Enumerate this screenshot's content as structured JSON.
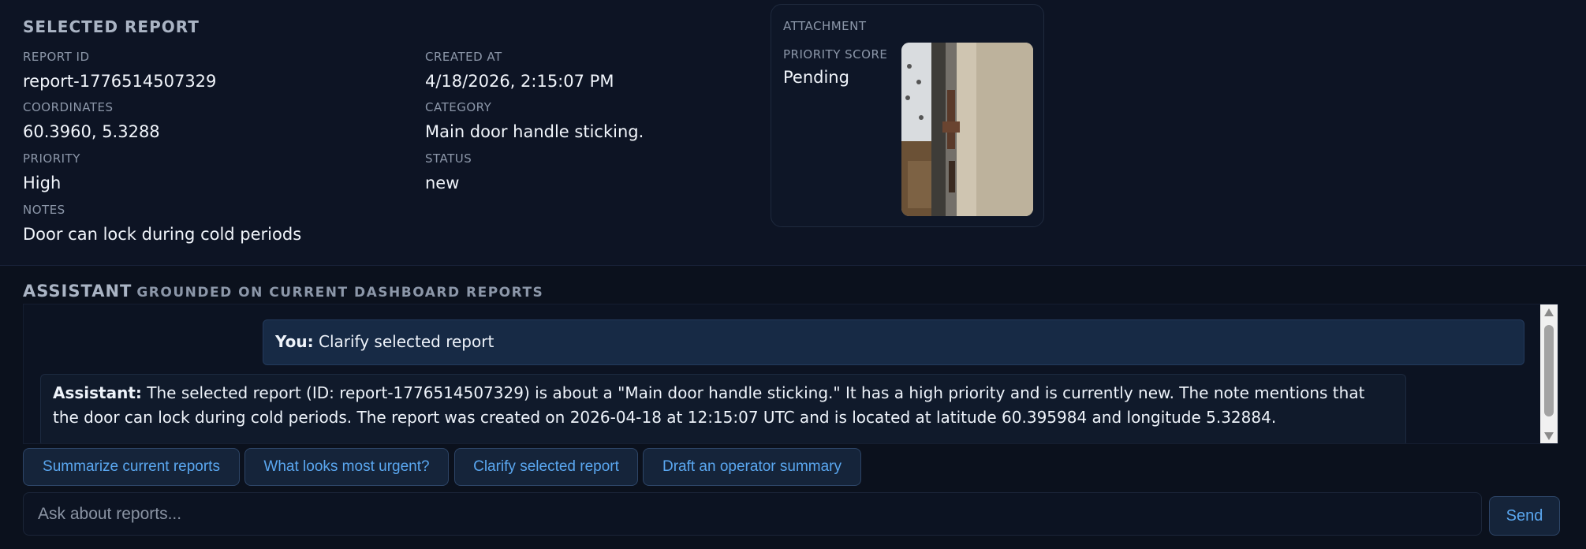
{
  "report": {
    "heading": "SELECTED REPORT",
    "fields": {
      "report_id": {
        "label": "REPORT ID",
        "value": "report-1776514507329"
      },
      "created_at": {
        "label": "CREATED AT",
        "value": "4/18/2026, 2:15:07 PM"
      },
      "coordinates": {
        "label": "COORDINATES",
        "value": "60.3960, 5.3288"
      },
      "category": {
        "label": "CATEGORY",
        "value": "Main door handle sticking."
      },
      "priority": {
        "label": "PRIORITY",
        "value": "High"
      },
      "status": {
        "label": "STATUS",
        "value": "new"
      },
      "notes": {
        "label": "NOTES",
        "value": "Door can lock during cold periods"
      }
    }
  },
  "attachment": {
    "heading": "ATTACHMENT",
    "priority_score_label": "PRIORITY SCORE",
    "priority_score_value": "Pending"
  },
  "assistant": {
    "heading": "ASSISTANT",
    "subheading": "GROUNDED ON CURRENT DASHBOARD REPORTS",
    "messages": [
      {
        "speaker": "You:",
        "text": " Clarify selected report"
      },
      {
        "speaker": "Assistant:",
        "text": " The selected report (ID: report-1776514507329) is about a \"Main door handle sticking.\" It has a high priority and is currently new. The note mentions that the door can lock during cold periods. The report was created on 2026-04-18 at 12:15:07 UTC and is located at latitude 60.395984 and longitude 5.32884."
      }
    ],
    "quick_actions": [
      "Summarize current reports",
      "What looks most urgent?",
      "Clarify selected report",
      "Draft an operator summary"
    ],
    "input_placeholder": "Ask about reports...",
    "send_label": "Send"
  }
}
